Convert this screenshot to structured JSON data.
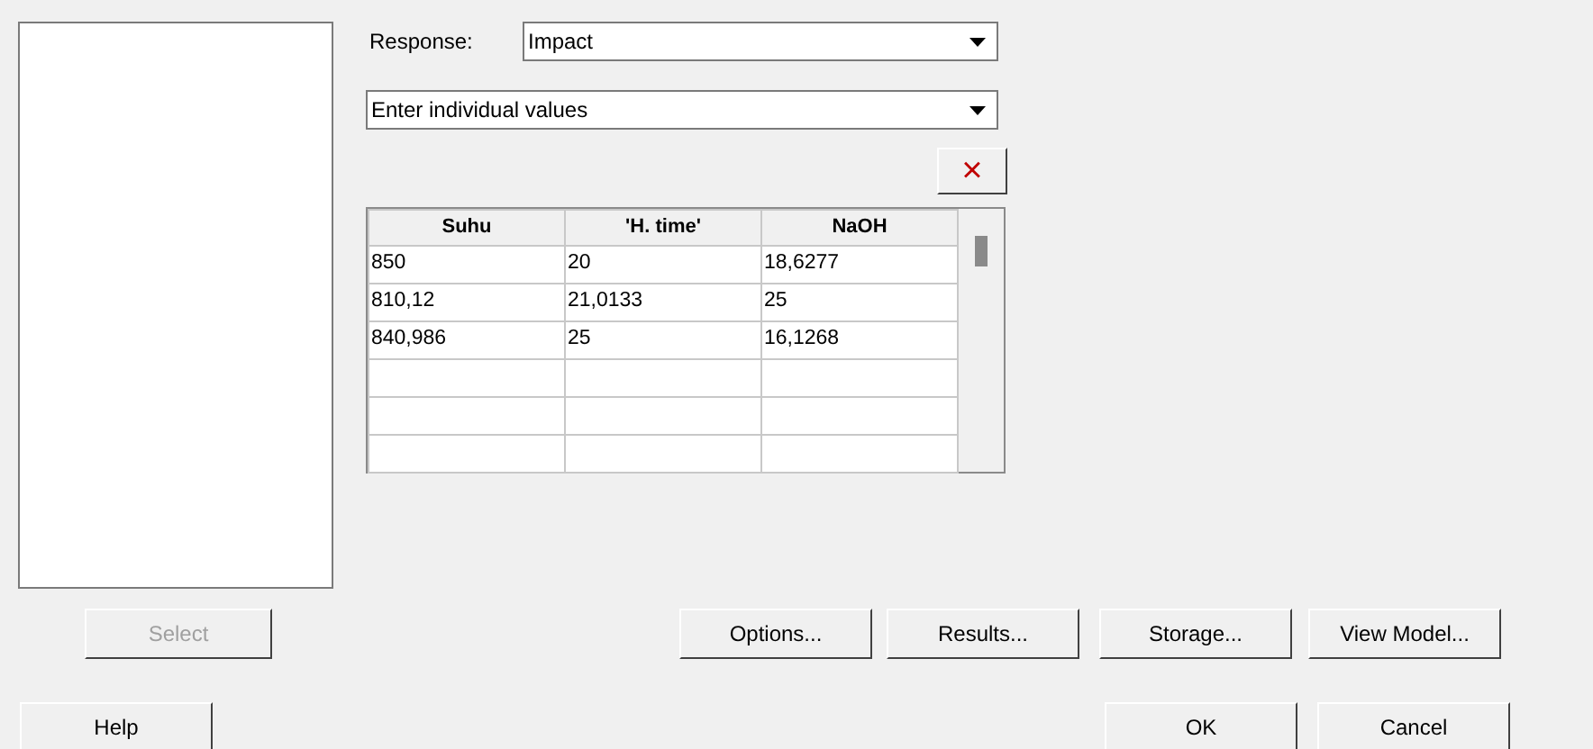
{
  "response": {
    "label": "Response:",
    "value": "Impact"
  },
  "entry_mode": {
    "value": "Enter individual values"
  },
  "delete_button": {
    "label": "×"
  },
  "table": {
    "columns": [
      "Suhu",
      "'H. time'",
      "NaOH"
    ],
    "rows": [
      [
        "850",
        "20",
        "18,6277"
      ],
      [
        "810,12",
        "21,0133",
        "25"
      ],
      [
        "840,986",
        "25",
        "16,1268"
      ],
      [
        "",
        "",
        ""
      ],
      [
        "",
        "",
        ""
      ],
      [
        "",
        "",
        ""
      ]
    ]
  },
  "select_button": {
    "label": "Select",
    "disabled": true
  },
  "option_buttons": [
    {
      "label": "Options..."
    },
    {
      "label": "Results..."
    },
    {
      "label": "Storage..."
    },
    {
      "label": "View Model..."
    }
  ],
  "bottom_buttons": [
    {
      "kind": "help",
      "label": "Help"
    },
    {
      "kind": "ok",
      "label": "OK"
    },
    {
      "kind": "cancel",
      "label": "Cancel"
    }
  ]
}
